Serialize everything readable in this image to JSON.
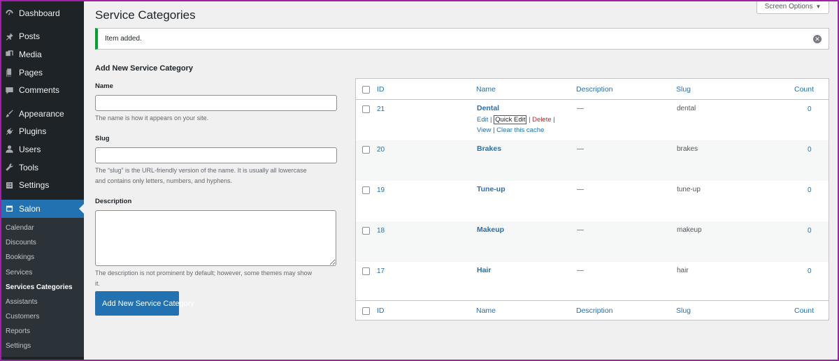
{
  "sidebar": {
    "items": [
      {
        "label": "Dashboard",
        "icon": "dashboard-icon"
      },
      {
        "label": "Posts",
        "icon": "pin-icon"
      },
      {
        "label": "Media",
        "icon": "media-icon"
      },
      {
        "label": "Pages",
        "icon": "pages-icon"
      },
      {
        "label": "Comments",
        "icon": "comment-icon"
      },
      {
        "label": "Appearance",
        "icon": "paintbrush-icon"
      },
      {
        "label": "Plugins",
        "icon": "plug-icon"
      },
      {
        "label": "Users",
        "icon": "user-icon"
      },
      {
        "label": "Tools",
        "icon": "wrench-icon"
      },
      {
        "label": "Settings",
        "icon": "settings-icon"
      },
      {
        "label": "Salon",
        "icon": "calendar-icon"
      }
    ],
    "submenu": [
      "Calendar",
      "Discounts",
      "Bookings",
      "Services",
      "Services Categories",
      "Assistants",
      "Customers",
      "Reports",
      "Settings"
    ]
  },
  "header": {
    "title": "Service Categories",
    "screen_options": "Screen Options"
  },
  "notice": {
    "text": "Item added.",
    "dismiss": "✕"
  },
  "form": {
    "heading": "Add New Service Category",
    "name_label": "Name",
    "name_help": "The name is how it appears on your site.",
    "slug_label": "Slug",
    "slug_help_1": "The “slug” is the URL-friendly version of the name. It is usually all lowercase",
    "slug_help_2": "and contains only letters, numbers, and hyphens.",
    "description_label": "Description",
    "description_help_1": "The description is not prominent by default; however, some themes may show",
    "description_help_2": "it.",
    "submit_label": "Add New Service Category"
  },
  "table": {
    "columns": {
      "id": "ID",
      "name": "Name",
      "description": "Description",
      "slug": "Slug",
      "count": "Count"
    },
    "row_actions": {
      "edit": "Edit",
      "quick_edit": "Quick Edit",
      "delete": "Delete",
      "view": "View",
      "clear_cache": "Clear this cache",
      "separator": "|"
    },
    "rows": [
      {
        "id": "21",
        "name": "Dental",
        "description": "—",
        "slug": "dental",
        "count": "0"
      },
      {
        "id": "20",
        "name": "Brakes",
        "description": "—",
        "slug": "brakes",
        "count": "0"
      },
      {
        "id": "19",
        "name": "Tune-up",
        "description": "—",
        "slug": "tune-up",
        "count": "0"
      },
      {
        "id": "18",
        "name": "Makeup",
        "description": "—",
        "slug": "makeup",
        "count": "0"
      },
      {
        "id": "17",
        "name": "Hair",
        "description": "—",
        "slug": "hair",
        "count": "0"
      }
    ]
  },
  "colors": {
    "accent": "#2271b1",
    "sidebar_bg": "#1d2327",
    "success": "#00a32a"
  }
}
